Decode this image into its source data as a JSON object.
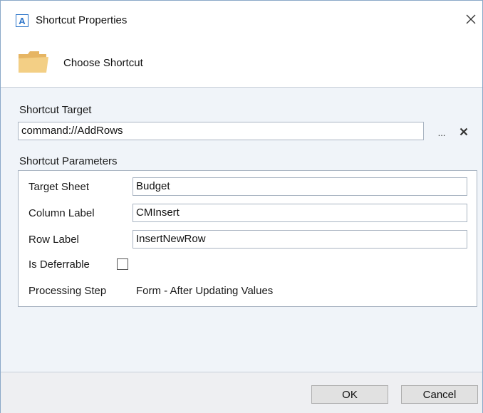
{
  "window": {
    "title": "Shortcut Properties",
    "app_icon_letter": "A",
    "close_icon": "close-icon"
  },
  "header": {
    "icon": "folder-icon",
    "label": "Choose Shortcut"
  },
  "target": {
    "label": "Shortcut Target",
    "value": "command://AddRows",
    "browse_label": "...",
    "clear_icon": "clear-icon"
  },
  "parameters": {
    "section_label": "Shortcut Parameters",
    "target_sheet": {
      "label": "Target Sheet",
      "value": "Budget"
    },
    "column_label": {
      "label": "Column Label",
      "value": "CMInsert"
    },
    "row_label": {
      "label": "Row Label",
      "value": "InsertNewRow"
    },
    "is_deferrable": {
      "label": "Is Deferrable",
      "checked": false
    },
    "processing_step": {
      "label": "Processing Step",
      "value": "Form - After Updating Values"
    }
  },
  "footer": {
    "ok_label": "OK",
    "cancel_label": "Cancel"
  },
  "colors": {
    "accent": "#2b74c9",
    "folder": "#f0c77a",
    "body_background": "#f0f4f9"
  }
}
